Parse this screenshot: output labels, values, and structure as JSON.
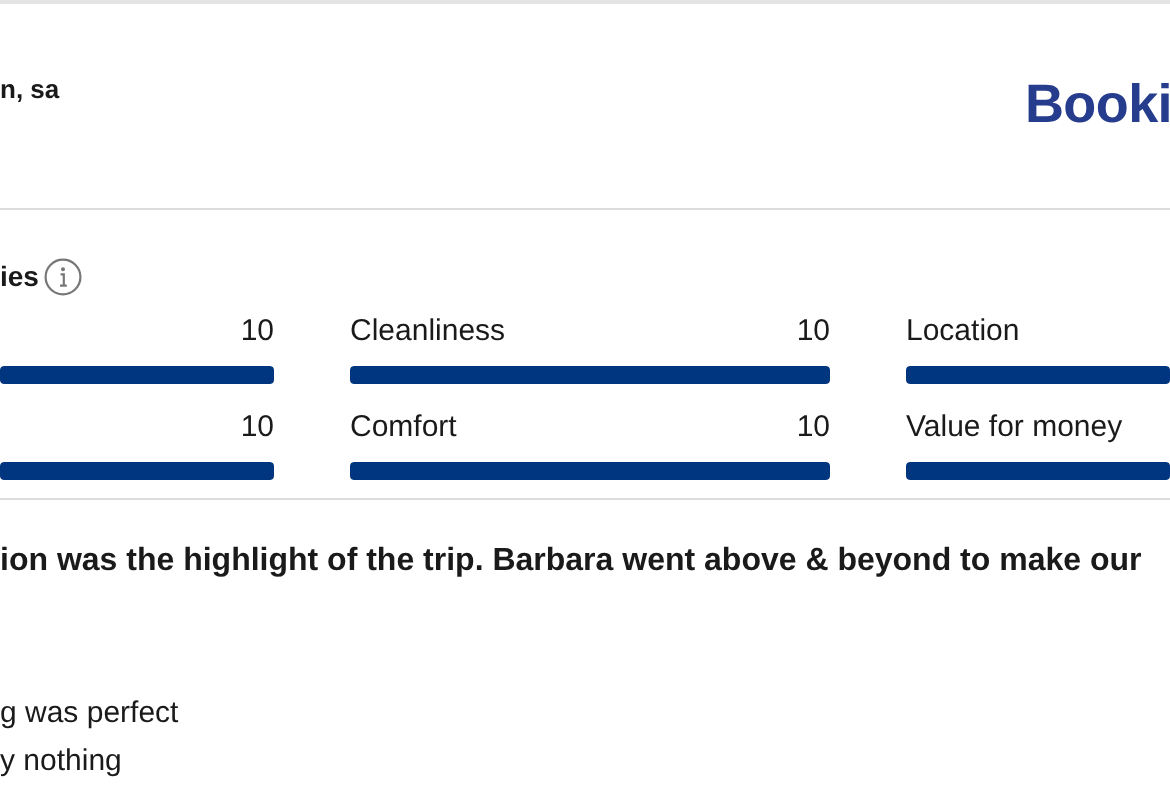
{
  "header": {
    "guest_name": "n, sa",
    "logo": "Booki"
  },
  "scores": {
    "title": "ies",
    "rows": [
      [
        {
          "score": "10",
          "level": 1
        },
        {
          "label": "Cleanliness",
          "score": "10",
          "level": 1
        },
        {
          "label": "Location",
          "level": 1
        }
      ],
      [
        {
          "score": "10",
          "level": 1
        },
        {
          "label": "Comfort",
          "score": "10",
          "level": 1
        },
        {
          "label": "Value for money",
          "level": 1
        }
      ]
    ]
  },
  "review": {
    "headline": "ion was the highlight of the trip. Barbara went above & beyond to make our",
    "lines": [
      "g was perfect",
      "y nothing"
    ]
  }
}
